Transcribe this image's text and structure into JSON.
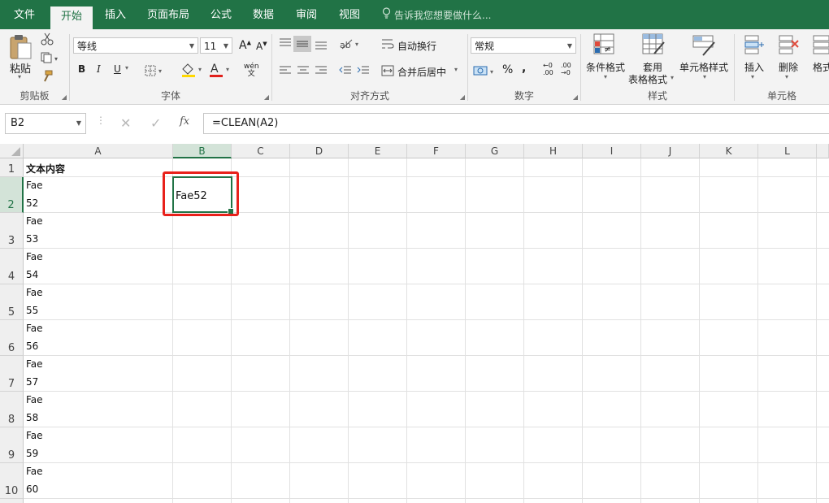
{
  "menu": {
    "tabs": [
      "文件",
      "开始",
      "插入",
      "页面布局",
      "公式",
      "数据",
      "审阅",
      "视图"
    ],
    "active_tab": "开始",
    "tell_me": "告诉我您想要做什么..."
  },
  "ribbon": {
    "clipboard": {
      "label": "剪贴板",
      "paste": "粘贴"
    },
    "font": {
      "label": "字体",
      "name": "等线",
      "size": "11",
      "bold": "B",
      "italic": "I",
      "underline": "U",
      "phonetic": "wén"
    },
    "alignment": {
      "label": "对齐方式",
      "wrap_text": "自动换行",
      "merge_center": "合并后居中"
    },
    "number": {
      "label": "数字",
      "format": "常规",
      "percent": "%",
      "comma": ","
    },
    "styles": {
      "label": "样式",
      "conditional": "条件格式",
      "table_format_1": "套用",
      "table_format_2": "表格格式",
      "cell_styles": "单元格样式"
    },
    "cells": {
      "label": "单元格",
      "insert": "插入",
      "delete": "删除",
      "format": "格式"
    }
  },
  "formula_bar": {
    "name_box": "B2",
    "fx": "fx",
    "formula": "=CLEAN(A2)"
  },
  "sheet": {
    "columns": [
      "A",
      "B",
      "C",
      "D",
      "E",
      "F",
      "G",
      "H",
      "I",
      "J",
      "K",
      "L"
    ],
    "selected_column": "B",
    "selected_row": "2",
    "header": "文本内容",
    "rows": [
      {
        "num": "1",
        "a": [
          "文本内容"
        ],
        "b": ""
      },
      {
        "num": "2",
        "a": [
          "Fae",
          "52"
        ],
        "b": "Fae52"
      },
      {
        "num": "3",
        "a": [
          "Fae",
          "53"
        ],
        "b": ""
      },
      {
        "num": "4",
        "a": [
          "Fae",
          "54"
        ],
        "b": ""
      },
      {
        "num": "5",
        "a": [
          "Fae",
          "55"
        ],
        "b": ""
      },
      {
        "num": "6",
        "a": [
          "Fae",
          "56"
        ],
        "b": ""
      },
      {
        "num": "7",
        "a": [
          "Fae",
          "57"
        ],
        "b": ""
      },
      {
        "num": "8",
        "a": [
          "Fae",
          "58"
        ],
        "b": ""
      },
      {
        "num": "9",
        "a": [
          "Fae",
          "59"
        ],
        "b": ""
      },
      {
        "num": "10",
        "a": [
          "Fae",
          "60"
        ],
        "b": ""
      }
    ]
  },
  "colors": {
    "accent": "#217346",
    "highlight": "#e8211b",
    "font_color_bar": "#e0201b"
  }
}
